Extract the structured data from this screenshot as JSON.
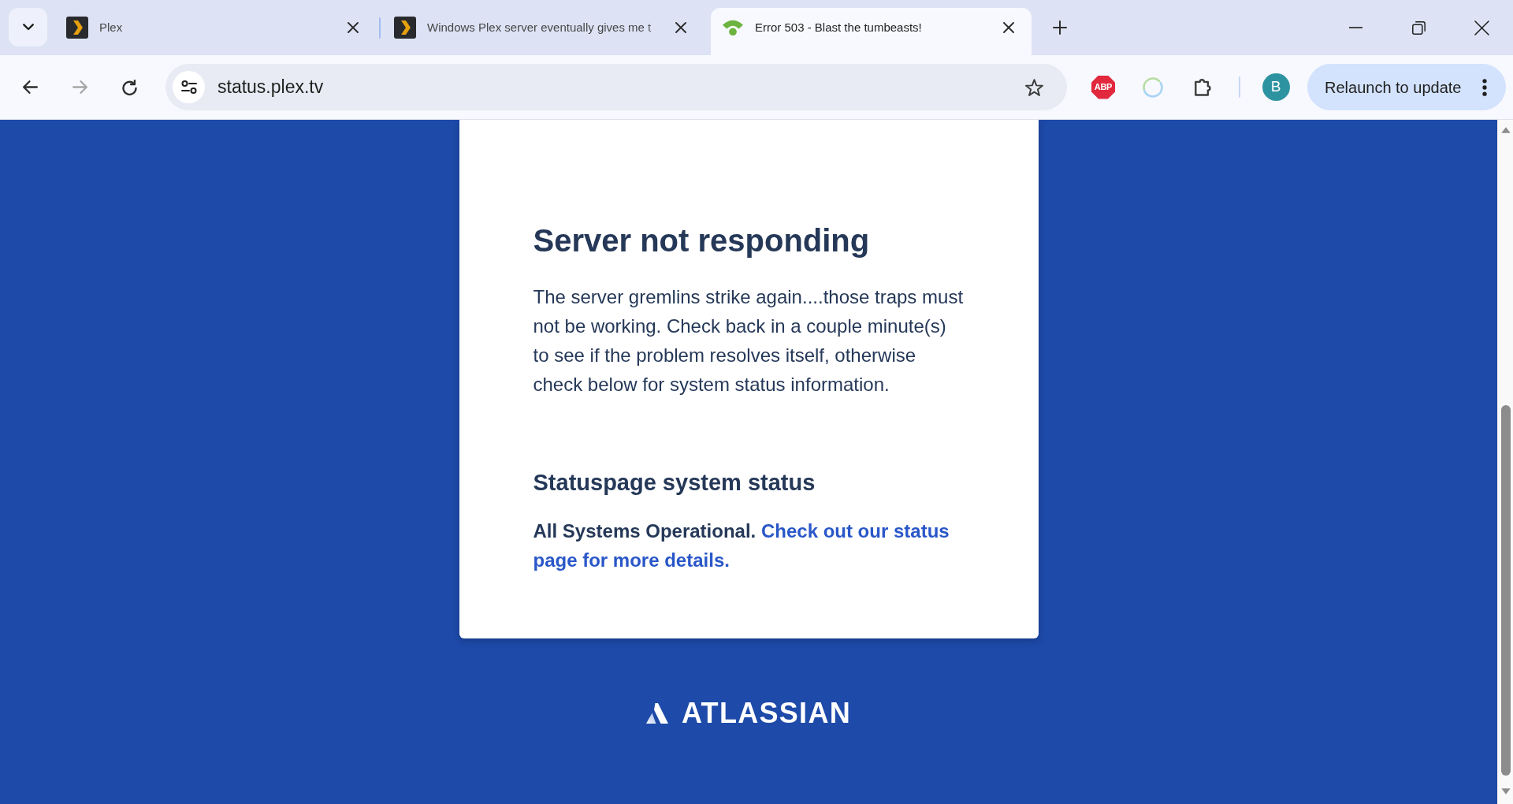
{
  "browser": {
    "tabs": [
      {
        "kind": "plex",
        "title": "Plex",
        "selected": false
      },
      {
        "kind": "plex",
        "title": "Windows Plex server eventually gives me t",
        "selected": false
      },
      {
        "kind": "status",
        "title": "Error 503 - Blast the tumbeasts!",
        "selected": true
      }
    ],
    "navigation": [
      {
        "kind": "back",
        "disabled": false
      },
      {
        "kind": "forward",
        "disabled": true
      },
      {
        "kind": "reload",
        "disabled": false
      }
    ],
    "address_bar": {
      "url": "status.plex.tv",
      "bookmarked": false
    },
    "extensions": [
      {
        "kind": "adblock",
        "label": "ABP"
      },
      {
        "kind": "ring"
      }
    ],
    "profile": {
      "initial": "B"
    },
    "relaunch_button": {
      "label": "Relaunch to update"
    }
  },
  "page": {
    "error_card": {
      "title": "Server not responding",
      "message": "The server gremlins strike again....those traps must not be working. Check back in a couple minute(s) to see if the problem resolves itself, otherwise check below for system status information.",
      "status_title": "Statuspage system status",
      "status_summary": "All Systems Operational.",
      "status_link": "Check out our status page for more details."
    },
    "footer_logo": {
      "wordmark": "ATLASSIAN"
    }
  }
}
